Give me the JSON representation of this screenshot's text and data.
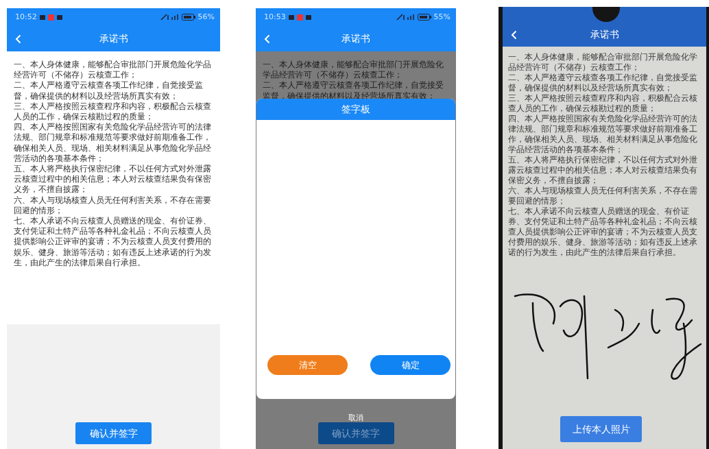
{
  "screens": [
    {
      "kind": "plain",
      "status_bar": {
        "time": "10:52",
        "battery": "56%"
      },
      "title": "承诺书",
      "paragraphs": [
        "一、本人身体健康，能够配合审批部门开展危险化学品经营许可（不储存）云核查工作；",
        "二、本人严格遵守云核查各项工作纪律，自觉接受监督，确保提供的材料以及经营场所真实有效；",
        "三、本人严格按照云核查程序和内容，积极配合云核查人员的工作，确保云核勘过程的质量；",
        "四、本人严格按照国家有关危险化学品经营许可的法律法规、部门规章和标准规范等要求做好前期准备工作，确保相关人员、现场、相关材料满足从事危险化学品经营活动的各项基本条件；",
        "五、本人将严格执行保密纪律，不以任何方式对外泄露云核查过程中的相关信息；本人对云核查结果负有保密义务，不擅自披露；",
        "六、本人与现场核查人员无任何利害关系，不存在需要回避的情形；",
        "七、本人承诺不向云核查人员赠送的现金、有价证券、支付凭证和土特产品等各种礼金礼品；不向云核查人员提供影响公正评审的宴请；不为云核查人员支付费用的娱乐、健身、旅游等活动；如有违反上述承诺的行为发生，由此产生的法律后果自行承担。"
      ],
      "bottom_button": "确认并签字"
    },
    {
      "kind": "dialog",
      "status_bar": {
        "time": "10:53",
        "battery": "55%"
      },
      "title": "承诺书",
      "paragraphs": [
        "一、本人身体健康，能够配合审批部门开展危险化学品经营许可（不储存）云核查工作；",
        "二、本人严格遵守云核查各项工作纪律，自觉接受监督，确保提供的材料以及经营场所真实有效；"
      ],
      "dialog": {
        "title": "签字板",
        "buttons": [
          {
            "label": "清空",
            "kind": "clear"
          },
          {
            "label": "确定",
            "kind": "confirm"
          }
        ],
        "cancel": "取消"
      },
      "bottom_button": "确认并签字"
    },
    {
      "kind": "photo",
      "title": "承诺书",
      "paragraphs": [
        "一、本人身体健康，能够配合审批部门开展危险化学品经营许可（不储存）云核查工作；",
        "二、本人严格遵守云核查各项工作纪律，自觉接受监督，确保提供的材料以及经营场所真实有效；",
        "三、本人严格按照云核查程序和内容，积极配合云核查人员的工作，确保云核勘过程的质量；",
        "四、本人严格按照国家有关危险化学品经营许可的法律法规、部门规章和标准规范等要求做好前期准备工作，确保相关人员、现场、相关材料满足从事危险化学品经营活动的各项基本条件；",
        "五、本人将严格执行保密纪律，不以任何方式对外泄露云核查过程中的相关信息；本人对云核查结果负有保密义务，不擅自披露；",
        "六、本人与现场核查人员无任何利害关系，不存在需要回避的情形；",
        "七、本人承诺不向云核查人员赠送的现金、有价证券、支付凭证和土特产品等各种礼金礼品；不向云核查人员提供影响公正评审的宴请；不为云核查人员支付费用的娱乐、健身、旅游等活动；如有违反上述承诺的行为发生，由此产生的法律后果自行承担。"
      ],
      "bottom_button": "上传本人照片"
    }
  ]
}
